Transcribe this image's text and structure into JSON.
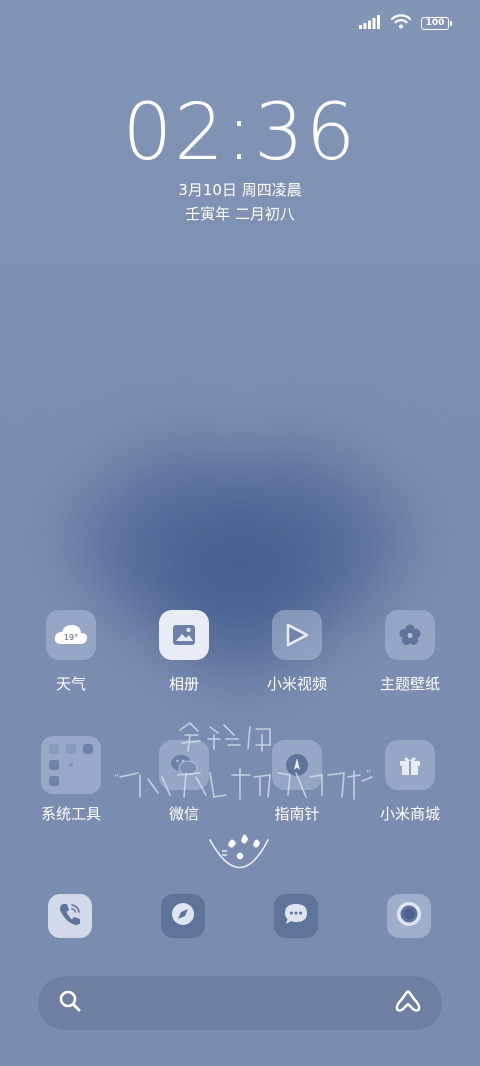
{
  "status_bar": {
    "battery_level": "100",
    "signal_icon": "signal-bars-icon",
    "wifi_icon": "wifi-icon"
  },
  "lock": {
    "time": "02:36",
    "date": "3月10日 周四凌晨",
    "lunar": "壬寅年 二月初八"
  },
  "apps_row1": [
    {
      "label": "天气",
      "icon": "weather-cloud-icon",
      "temp": "19°"
    },
    {
      "label": "相册",
      "icon": "gallery-icon"
    },
    {
      "label": "小米视频",
      "icon": "video-play-icon"
    },
    {
      "label": "主题壁纸",
      "icon": "theme-flower-icon"
    }
  ],
  "apps_row2": [
    {
      "label": "系统工具",
      "icon": "folder-icon"
    },
    {
      "label": "微信",
      "icon": "wechat-icon"
    },
    {
      "label": "指南针",
      "icon": "compass-icon"
    },
    {
      "label": "小米商城",
      "icon": "gift-icon"
    }
  ],
  "dock": [
    {
      "icon": "phone-icon"
    },
    {
      "icon": "browser-compass-icon"
    },
    {
      "icon": "message-bubble-icon"
    },
    {
      "icon": "camera-icon"
    }
  ],
  "search": {
    "icon": "search-icon",
    "assistant_icon": "xiaoai-icon"
  },
  "colors": {
    "wallpaper": "#7d8fb0",
    "heart": "#4c6594",
    "icon_tile": "#b3c0d8"
  }
}
